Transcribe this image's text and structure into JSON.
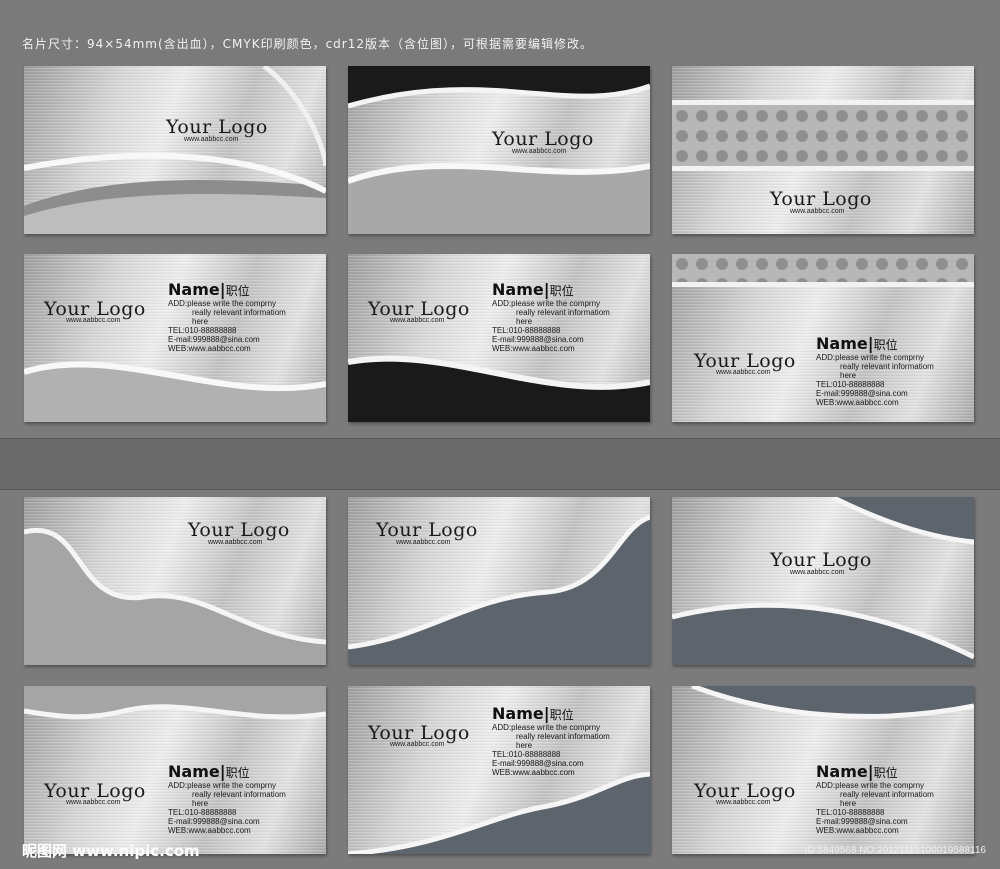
{
  "header": "名片尺寸：94×54mm(含出血），CMYK印刷颜色，cdr12版本（含位图），可根据需要编辑修改。",
  "logo_text": "Your Logo",
  "url_text": "www.aabbcc.com",
  "contact": {
    "name": "Name",
    "title": "职位",
    "add1": "ADD:please write the comprny",
    "add2": "really relevant informatiom",
    "add3": "here",
    "tel": "TEL:010-88888888",
    "email": "E-mail:999888@sina.com",
    "web": "WEB:www.aabbcc.com"
  },
  "watermark": "昵图网 www.nipic.com",
  "image_id": "ID:5849568 NO:20121115100019588116"
}
